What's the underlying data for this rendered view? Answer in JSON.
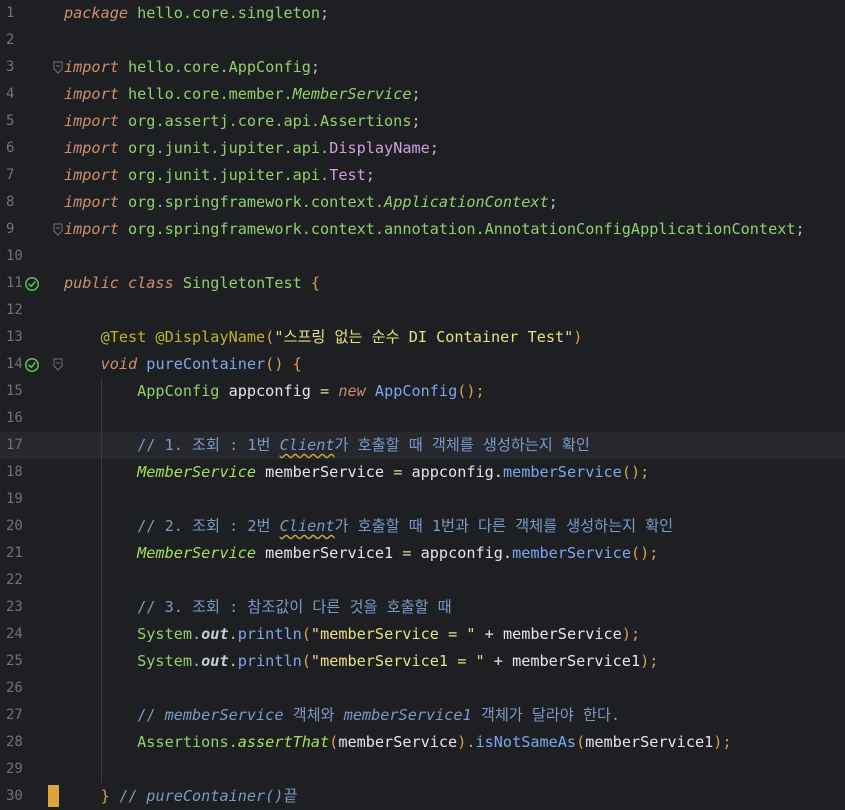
{
  "editor": {
    "lines": [
      {
        "n": "1",
        "tokens": [
          {
            "t": "package",
            "c": "kw"
          },
          {
            "t": " hello.core.singleton",
            "c": "pkg"
          },
          {
            "t": ";",
            "c": "plain"
          }
        ]
      },
      {
        "n": "2",
        "tokens": []
      },
      {
        "n": "3",
        "fold": true,
        "tokens": [
          {
            "t": "import",
            "c": "kw"
          },
          {
            "t": " hello.core.AppConfig",
            "c": "pkg"
          },
          {
            "t": ";",
            "c": "plain"
          }
        ]
      },
      {
        "n": "4",
        "tokens": [
          {
            "t": "import",
            "c": "kw"
          },
          {
            "t": " hello.core.member.",
            "c": "pkg"
          },
          {
            "t": "MemberService",
            "c": "ital-cls"
          },
          {
            "t": ";",
            "c": "plain"
          }
        ]
      },
      {
        "n": "5",
        "tokens": [
          {
            "t": "import",
            "c": "kw"
          },
          {
            "t": " org.assertj.core.api.Assertions",
            "c": "pkg"
          },
          {
            "t": ";",
            "c": "plain"
          }
        ]
      },
      {
        "n": "6",
        "tokens": [
          {
            "t": "import",
            "c": "kw"
          },
          {
            "t": " org.junit.jupiter.api.",
            "c": "pkg"
          },
          {
            "t": "DisplayName",
            "c": "purple"
          },
          {
            "t": ";",
            "c": "plain"
          }
        ]
      },
      {
        "n": "7",
        "tokens": [
          {
            "t": "import",
            "c": "kw"
          },
          {
            "t": " org.junit.jupiter.api.",
            "c": "pkg"
          },
          {
            "t": "Test",
            "c": "purple"
          },
          {
            "t": ";",
            "c": "plain"
          }
        ]
      },
      {
        "n": "8",
        "tokens": [
          {
            "t": "import",
            "c": "kw"
          },
          {
            "t": " org.springframework.context.",
            "c": "pkg"
          },
          {
            "t": "ApplicationContext",
            "c": "ital-cls"
          },
          {
            "t": ";",
            "c": "plain"
          }
        ]
      },
      {
        "n": "9",
        "fold": true,
        "tokens": [
          {
            "t": "import",
            "c": "kw"
          },
          {
            "t": " org.springframework.context.annotation.AnnotationConfigApplicationContext",
            "c": "pkg"
          },
          {
            "t": ";",
            "c": "plain"
          }
        ]
      },
      {
        "n": "10",
        "tokens": []
      },
      {
        "n": "11",
        "run": true,
        "tokens": [
          {
            "t": "public class",
            "c": "kw"
          },
          {
            "t": " SingletonTest ",
            "c": "cls"
          },
          {
            "t": "{",
            "c": "punc"
          }
        ]
      },
      {
        "n": "12",
        "tokens": []
      },
      {
        "n": "13",
        "tokens": [
          {
            "t": "    @Test @DisplayName",
            "c": "ann"
          },
          {
            "t": "(",
            "c": "punc"
          },
          {
            "t": "\"스프링 없는 순수 DI Container Test\"",
            "c": "str"
          },
          {
            "t": ")",
            "c": "punc"
          }
        ]
      },
      {
        "n": "14",
        "run": true,
        "fold": true,
        "tokens": [
          {
            "t": "    void",
            "c": "kw"
          },
          {
            "t": " pureContainer",
            "c": "fn"
          },
          {
            "t": "() {",
            "c": "punc"
          }
        ]
      },
      {
        "n": "15",
        "tokens": [
          {
            "t": "        AppConfig",
            "c": "cls"
          },
          {
            "t": " appconfig ",
            "c": "lv"
          },
          {
            "t": "=",
            "c": "op"
          },
          {
            "t": " new",
            "c": "kw"
          },
          {
            "t": " AppConfig",
            "c": "fn"
          },
          {
            "t": "();",
            "c": "punc"
          }
        ]
      },
      {
        "n": "16",
        "tokens": []
      },
      {
        "n": "17",
        "current": true,
        "tokens": [
          {
            "t": "        // 1. 조회 : 1번 ",
            "c": "cmt"
          },
          {
            "t": "Client",
            "c": "cmt-i squig"
          },
          {
            "t": "가 호출할 때 객체를 생성하는지 확인",
            "c": "cmt"
          }
        ]
      },
      {
        "n": "18",
        "tokens": [
          {
            "t": "        MemberService",
            "c": "type-i"
          },
          {
            "t": " memberService ",
            "c": "lv"
          },
          {
            "t": "=",
            "c": "op"
          },
          {
            "t": " appconfig.",
            "c": "lv"
          },
          {
            "t": "memberService",
            "c": "fn"
          },
          {
            "t": "();",
            "c": "punc"
          }
        ]
      },
      {
        "n": "19",
        "tokens": []
      },
      {
        "n": "20",
        "tokens": [
          {
            "t": "        // 2. 조회 : 2번 ",
            "c": "cmt"
          },
          {
            "t": "Client",
            "c": "cmt-i squig"
          },
          {
            "t": "가 호출할 때 1번과 다른 객체를 생성하는지 확인",
            "c": "cmt"
          }
        ]
      },
      {
        "n": "21",
        "tokens": [
          {
            "t": "        MemberService",
            "c": "type-i"
          },
          {
            "t": " memberService1 ",
            "c": "lv"
          },
          {
            "t": "=",
            "c": "op"
          },
          {
            "t": " appconfig.",
            "c": "lv"
          },
          {
            "t": "memberService",
            "c": "fn"
          },
          {
            "t": "();",
            "c": "punc"
          }
        ]
      },
      {
        "n": "22",
        "tokens": []
      },
      {
        "n": "23",
        "tokens": [
          {
            "t": "        // 3. 조회 : 참조값이 다른 것을 호출할 때",
            "c": "cmt"
          }
        ]
      },
      {
        "n": "24",
        "tokens": [
          {
            "t": "        System.",
            "c": "cls"
          },
          {
            "t": "out",
            "c": "field"
          },
          {
            "t": ".",
            "c": "plain"
          },
          {
            "t": "println",
            "c": "fn"
          },
          {
            "t": "(",
            "c": "punc"
          },
          {
            "t": "\"memberService = \"",
            "c": "str"
          },
          {
            "t": " + memberService",
            "c": "lv"
          },
          {
            "t": ");",
            "c": "punc"
          }
        ]
      },
      {
        "n": "25",
        "tokens": [
          {
            "t": "        System.",
            "c": "cls"
          },
          {
            "t": "out",
            "c": "field"
          },
          {
            "t": ".",
            "c": "plain"
          },
          {
            "t": "println",
            "c": "fn"
          },
          {
            "t": "(",
            "c": "punc"
          },
          {
            "t": "\"memberService1 = \"",
            "c": "str"
          },
          {
            "t": " + memberService1",
            "c": "lv"
          },
          {
            "t": ");",
            "c": "punc"
          }
        ]
      },
      {
        "n": "26",
        "tokens": []
      },
      {
        "n": "27",
        "tokens": [
          {
            "t": "        // ",
            "c": "cmt"
          },
          {
            "t": "memberService",
            "c": "cmt-i"
          },
          {
            "t": " 객체와 ",
            "c": "cmt"
          },
          {
            "t": "memberService1",
            "c": "cmt-i"
          },
          {
            "t": " 객체가 달라야 한다.",
            "c": "cmt"
          }
        ]
      },
      {
        "n": "28",
        "tokens": [
          {
            "t": "        Assertions.",
            "c": "cls"
          },
          {
            "t": "assertThat",
            "c": "type-i"
          },
          {
            "t": "(",
            "c": "punc"
          },
          {
            "t": "memberService",
            "c": "lv"
          },
          {
            "t": ").",
            "c": "punc"
          },
          {
            "t": "isNotSameAs",
            "c": "fn"
          },
          {
            "t": "(",
            "c": "punc"
          },
          {
            "t": "memberService1",
            "c": "lv"
          },
          {
            "t": ");",
            "c": "punc"
          }
        ]
      },
      {
        "n": "29",
        "tokens": []
      },
      {
        "n": "30",
        "caret": true,
        "tokens": [
          {
            "t": "    }",
            "c": "punc"
          },
          {
            "t": " // ",
            "c": "cmt"
          },
          {
            "t": "pureContainer()",
            "c": "cmt-i"
          },
          {
            "t": "끝",
            "c": "cmt"
          }
        ]
      }
    ]
  }
}
